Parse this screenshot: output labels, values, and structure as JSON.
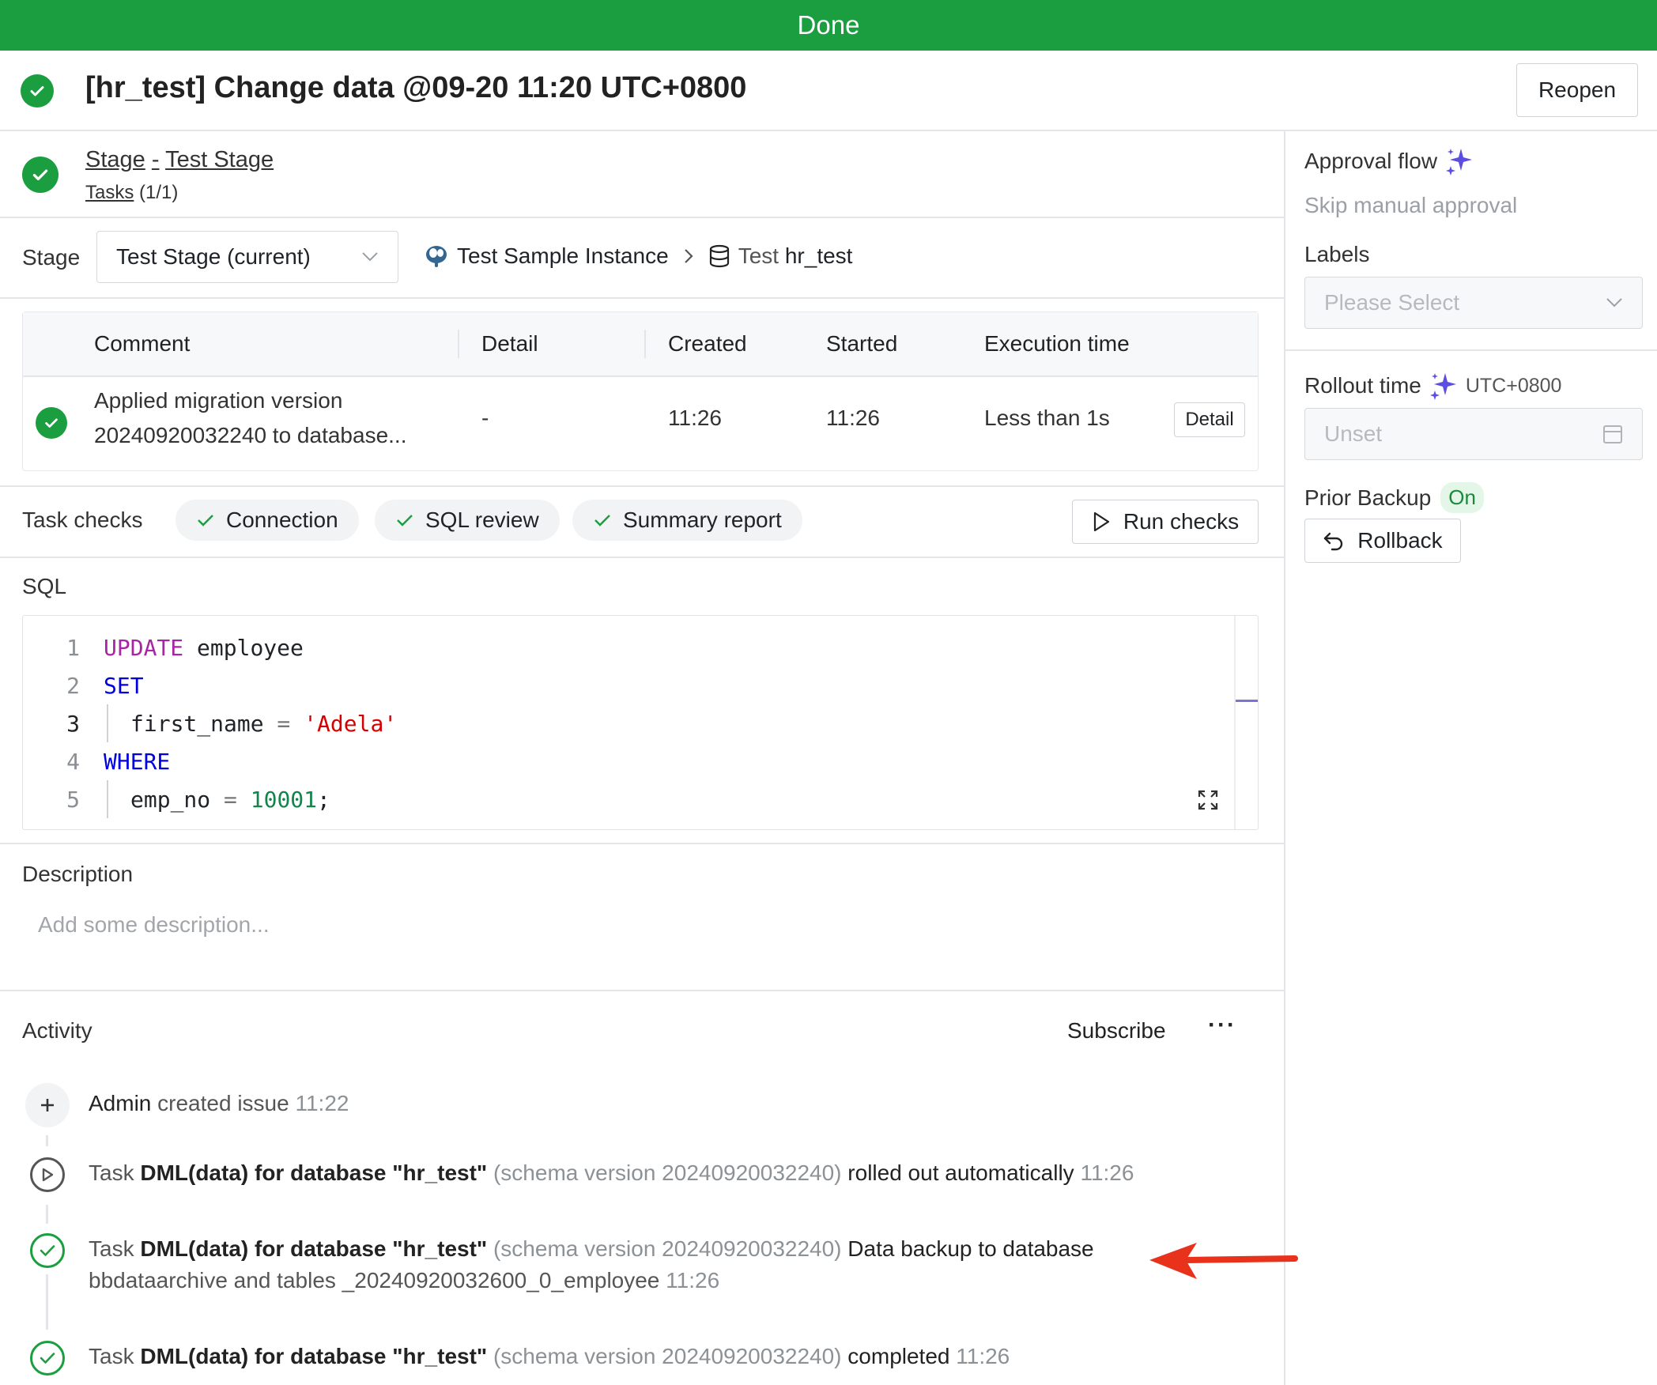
{
  "banner": {
    "status": "Done",
    "color": "#1a9e3f"
  },
  "header": {
    "title": "[hr_test] Change data @09-20 11:20 UTC+0800",
    "reopen_label": "Reopen"
  },
  "stage_summary": {
    "stage_link": "Stage",
    "separator": "-",
    "stage_name": "Test Stage",
    "tasks_link": "Tasks",
    "tasks_count": "(1/1)"
  },
  "stage_row": {
    "label": "Stage",
    "selected": "Test Stage (current)",
    "instance": "Test Sample Instance",
    "db_env": "Test",
    "db_name": "hr_test"
  },
  "task_table": {
    "columns": [
      "Comment",
      "Detail",
      "Created",
      "Started",
      "Execution time"
    ],
    "rows": [
      {
        "comment_line1": "Applied migration version",
        "comment_line2": "20240920032240 to database...",
        "detail": "-",
        "created": "11:26",
        "started": "11:26",
        "execution_time": "Less than 1s",
        "action": "Detail"
      }
    ]
  },
  "task_checks": {
    "label": "Task checks",
    "checks": [
      "Connection",
      "SQL review",
      "Summary report"
    ],
    "run_button": "Run checks"
  },
  "sql": {
    "label": "SQL",
    "lines": [
      {
        "n": "1",
        "parts": [
          "UPDATE",
          " employee"
        ]
      },
      {
        "n": "2",
        "parts": [
          "SET"
        ]
      },
      {
        "n": "3",
        "parts": [
          "first_name",
          " = ",
          "'Adela'"
        ]
      },
      {
        "n": "4",
        "parts": [
          "WHERE"
        ]
      },
      {
        "n": "5",
        "parts": [
          "emp_no",
          " = ",
          "10001",
          ";"
        ]
      }
    ]
  },
  "description": {
    "label": "Description",
    "placeholder": "Add some description..."
  },
  "activity": {
    "label": "Activity",
    "subscribe": "Subscribe",
    "more": "···",
    "items": [
      {
        "actor": "Admin",
        "action": " created issue ",
        "time": "11:22"
      },
      {
        "prefix": "Task ",
        "task": "DML(data) for database \"hr_test\"",
        "schema": " (schema version 20240920032240)",
        "action": " rolled out automatically ",
        "time": "11:26"
      },
      {
        "prefix": "Task ",
        "task": "DML(data) for database \"hr_test\"",
        "schema": " (schema version 20240920032240)",
        "action": " Data backup to database",
        "line2": "bbdataarchive and tables _20240920032600_0_employee ",
        "time": "11:26"
      },
      {
        "prefix": "Task ",
        "task": "DML(data) for database \"hr_test\"",
        "schema": " (schema version 20240920032240)",
        "action": " completed ",
        "time": "11:26"
      }
    ]
  },
  "sidebar": {
    "approval_flow": {
      "title": "Approval flow",
      "value": "Skip manual approval"
    },
    "labels": {
      "title": "Labels",
      "placeholder": "Please Select"
    },
    "rollout_time": {
      "title": "Rollout time",
      "timezone": "UTC+0800",
      "placeholder": "Unset"
    },
    "prior_backup": {
      "title": "Prior Backup",
      "badge": "On",
      "rollback_label": "Rollback"
    }
  },
  "colors": {
    "success": "#1a9e3f",
    "ai_sparkle": "#5b4ee0",
    "annotation_arrow": "#e8321c"
  }
}
